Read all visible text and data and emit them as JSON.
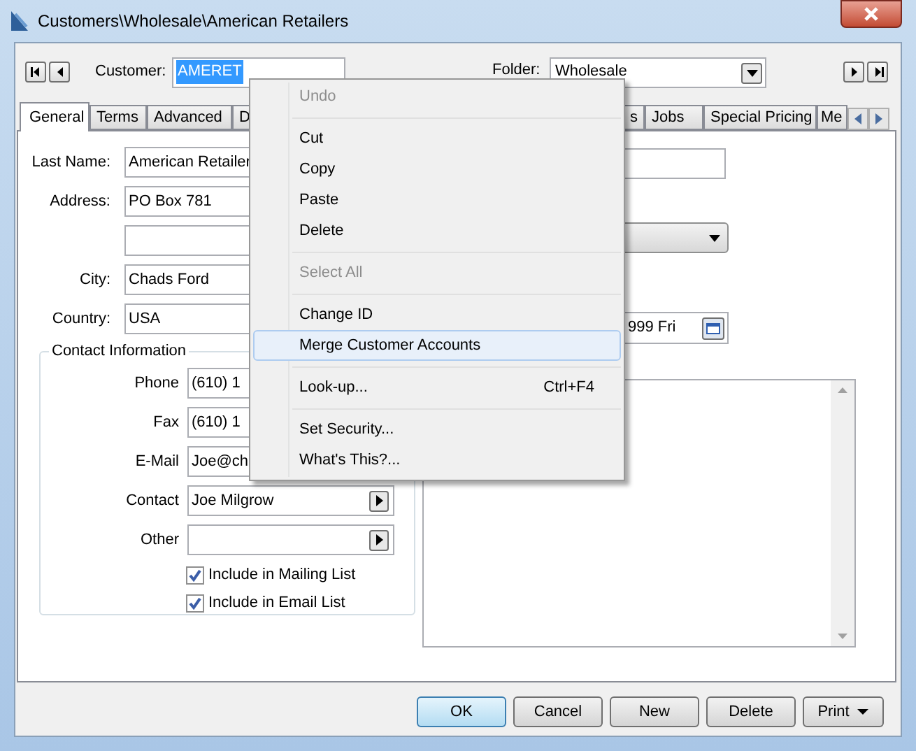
{
  "window": {
    "title": "Customers\\Wholesale\\American Retailers"
  },
  "header": {
    "customer_label": "Customer:",
    "customer_id": "AMERET",
    "customer_id_selected": true,
    "folder_label": "Folder:",
    "folder": "Wholesale"
  },
  "tabs": [
    {
      "label": "General",
      "selected": true
    },
    {
      "label": "Terms",
      "selected": false
    },
    {
      "label": "Advanced",
      "selected": false
    },
    {
      "label": "D",
      "selected": false
    },
    {
      "label": "s",
      "selected": false
    },
    {
      "label": "Jobs",
      "selected": false
    },
    {
      "label": "Special Pricing",
      "selected": false
    },
    {
      "label": "Me",
      "selected": false
    }
  ],
  "address_fields": [
    {
      "kind": "labeled",
      "label": "Last Name:",
      "value": "American Retailer"
    },
    {
      "kind": "labeled",
      "label": "Address:",
      "value": "PO Box 781"
    },
    {
      "kind": "blank"
    },
    {
      "kind": "labeled",
      "label": "City:",
      "value": "Chads Ford"
    },
    {
      "kind": "labeled",
      "label": "Country:",
      "value": "USA"
    }
  ],
  "contact_information": {
    "title": "Contact Information",
    "fields": [
      {
        "label": "Phone",
        "value": "(610) 1",
        "kind": "text"
      },
      {
        "label": "Fax",
        "value": "(610) 1",
        "kind": "text"
      },
      {
        "label": "E-Mail",
        "value": "Joe@ch",
        "kind": "text"
      },
      {
        "label": "Contact",
        "value": "Joe Milgrow",
        "kind": "picker"
      },
      {
        "label": "Other",
        "kind": "picker"
      }
    ],
    "checkboxes": [
      {
        "label": "Include in Mailing List",
        "checked": true
      },
      {
        "label": "Include in Email List",
        "checked": true
      }
    ]
  },
  "right_fields": [
    {
      "kind": "text"
    },
    {
      "kind": "dropdown"
    },
    {
      "kind": "date",
      "value": "999 Fri"
    },
    {
      "kind": "notes"
    }
  ],
  "context_menu": {
    "items": [
      {
        "kind": "item",
        "label": "Undo",
        "disabled": true,
        "selected": false
      },
      {
        "kind": "separator"
      },
      {
        "kind": "item",
        "label": "Cut",
        "disabled": false,
        "selected": false
      },
      {
        "kind": "item",
        "label": "Copy",
        "disabled": false,
        "selected": false
      },
      {
        "kind": "item",
        "label": "Paste",
        "disabled": false,
        "selected": false
      },
      {
        "kind": "item",
        "label": "Delete",
        "disabled": false,
        "selected": false
      },
      {
        "kind": "separator"
      },
      {
        "kind": "item",
        "label": "Select All",
        "disabled": true,
        "selected": false
      },
      {
        "kind": "separator"
      },
      {
        "kind": "item",
        "label": "Change ID",
        "disabled": false,
        "selected": false
      },
      {
        "kind": "item",
        "label": "Merge Customer Accounts",
        "disabled": false,
        "selected": true
      },
      {
        "kind": "separator"
      },
      {
        "kind": "item",
        "label": "Look-up...",
        "shortcut": "Ctrl+F4",
        "disabled": false,
        "selected": false
      },
      {
        "kind": "separator"
      },
      {
        "kind": "item",
        "label": "Set Security...",
        "disabled": false,
        "selected": false
      },
      {
        "kind": "item",
        "label": "What's This?...",
        "disabled": false,
        "selected": false
      }
    ]
  },
  "buttons": [
    {
      "label": "OK",
      "kind": "default"
    },
    {
      "label": "Cancel",
      "kind": "normal"
    },
    {
      "label": "New",
      "kind": "normal"
    },
    {
      "label": "Delete",
      "kind": "normal"
    },
    {
      "label": "Print",
      "kind": "menu"
    }
  ]
}
